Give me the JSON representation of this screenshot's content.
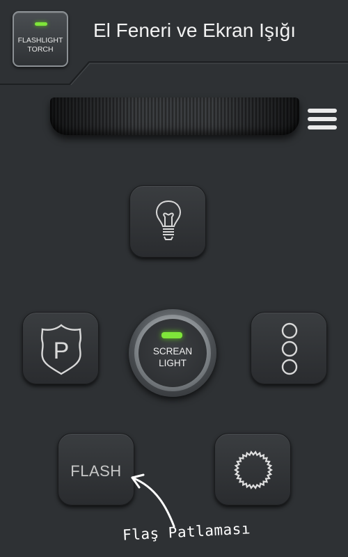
{
  "header": {
    "app_icon_label_line1": "FLASHLIGHT",
    "app_icon_label_line2": "TORCH",
    "title": "El Feneri ve Ekran Işığı"
  },
  "controls": {
    "center_button_line1": "SCREAN",
    "center_button_line2": "LIGHT",
    "flash_label": "FLASH"
  },
  "annotation": {
    "text": "Flaş Patlaması"
  },
  "icons": {
    "bulb": "lightbulb-icon",
    "police": "police-badge-icon",
    "traffic": "three-circles-icon",
    "strobe": "strobe-burst-icon",
    "menu": "hamburger-menu-icon"
  },
  "colors": {
    "background": "#2e3134",
    "led_green": "#7fe53a",
    "text": "#f2f2f2"
  }
}
